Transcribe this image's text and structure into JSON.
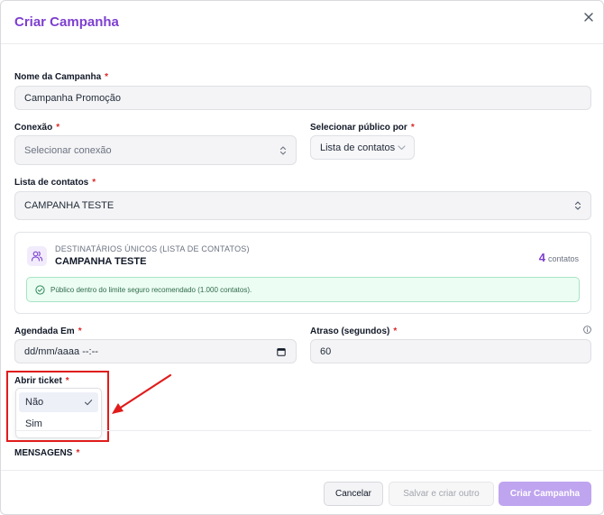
{
  "modal": {
    "title": "Criar Campanha"
  },
  "form": {
    "campaign_name": {
      "label": "Nome da Campanha",
      "required": "*",
      "value": "Campanha Promoção"
    },
    "connection": {
      "label": "Conexão",
      "required": "*",
      "placeholder": "Selecionar conexão"
    },
    "audience_by": {
      "label": "Selecionar público por",
      "required": "*",
      "value": "Lista de contatos"
    },
    "contact_list": {
      "label": "Lista de contatos",
      "required": "*",
      "value": "CAMPANHA TESTE"
    },
    "recipients": {
      "subtitle": "DESTINATÁRIOS ÚNICOS (LISTA DE CONTATOS)",
      "name": "CAMPANHA TESTE",
      "count": "4",
      "count_unit": "contatos",
      "notice": "Público dentro do limite seguro recomendado (1.000 contatos)."
    },
    "scheduled_at": {
      "label": "Agendada Em",
      "required": "*",
      "value": "dd/mm/aaaa --:--"
    },
    "delay": {
      "label": "Atraso (segundos)",
      "required": "*",
      "value": "60"
    },
    "open_ticket": {
      "label": "Abrir ticket",
      "required": "*",
      "options": [
        "Não",
        "Sim"
      ],
      "selected": "Não"
    },
    "messages": {
      "label": "MENSAGENS",
      "required": "*"
    }
  },
  "footer": {
    "cancel": "Cancelar",
    "save_and_create": "Salvar e criar outro",
    "create": "Criar Campanha"
  },
  "colors": {
    "accent": "#7e3fd0",
    "required": "#dc2626",
    "annotation": "#e11b1b",
    "success_bg": "#ecfdf3"
  }
}
